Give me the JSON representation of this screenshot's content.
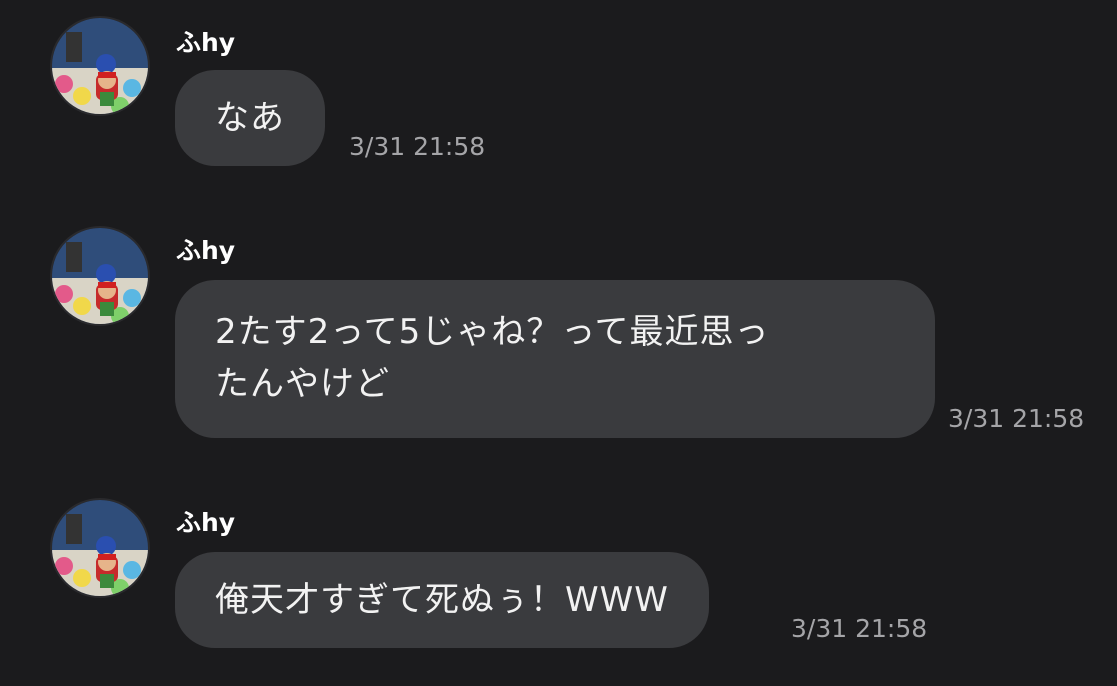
{
  "messages": [
    {
      "sender": "ふhy",
      "text": "なあ",
      "time": "3/31 21:58"
    },
    {
      "sender": "ふhy",
      "text_line1": "2たす2って5じゃね？って最近思っ",
      "text_line2": "たんやけど",
      "time": "3/31 21:58"
    },
    {
      "sender": "ふhy",
      "text": "俺天才すぎて死ぬぅ！WWW",
      "time": "3/31 21:58"
    }
  ],
  "colors": {
    "background": "#1b1b1d",
    "bubble": "#3a3b3e",
    "timestamp": "#a5a5a8"
  },
  "icons": {
    "avatar": "user-avatar-icon"
  }
}
